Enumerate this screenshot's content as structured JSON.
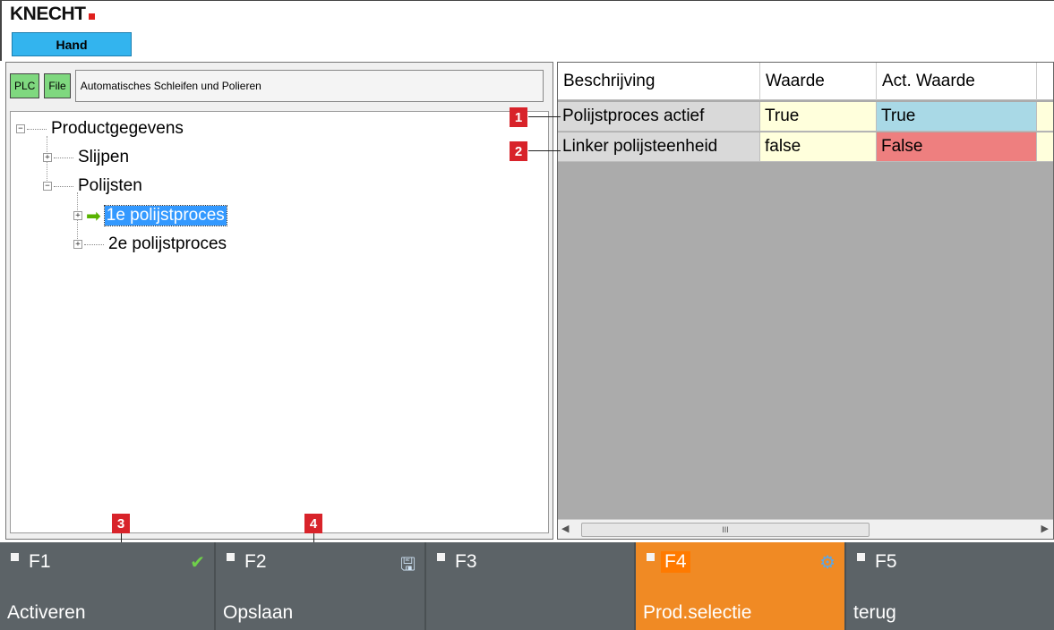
{
  "header": {
    "logo_text": "KNECHT",
    "mode": "Hand"
  },
  "left_panel": {
    "path_buttons": [
      "PLC",
      "File"
    ],
    "path_text": "Automatisches Schleifen und Polieren",
    "tree": [
      {
        "label": "Productgegevens",
        "toggle": "−",
        "level": 0
      },
      {
        "label": "Slijpen",
        "toggle": "+",
        "level": 1
      },
      {
        "label": "Polijsten",
        "toggle": "−",
        "level": 1
      },
      {
        "label": "1e polijstproces",
        "toggle": "+",
        "level": 2,
        "selected": true
      },
      {
        "label": "2e polijstproces",
        "toggle": "+",
        "level": 2
      }
    ]
  },
  "grid": {
    "columns": [
      "Beschrijving",
      "Waarde",
      "Act. Waarde"
    ],
    "rows": [
      {
        "description": "Polijstproces actief",
        "value": "True",
        "actual": "True",
        "actual_color": "#a9d9e6"
      },
      {
        "description": "Linker polijsteenheid",
        "value": "false",
        "actual": "False",
        "actual_color": "#ee7f7f"
      }
    ],
    "scroll_grip": "III"
  },
  "callouts": [
    "1",
    "2",
    "3",
    "4"
  ],
  "function_keys": [
    {
      "code": "F1",
      "label": "Activeren",
      "icon": "check-icon",
      "glyph": "✔",
      "icon_color": "#6fd04a",
      "active": false
    },
    {
      "code": "F2",
      "label": "Opslaan",
      "icon": "save-icon",
      "glyph": "🖫",
      "icon_color": "#cfe3f5",
      "active": false
    },
    {
      "code": "F3",
      "label": "",
      "active": false
    },
    {
      "code": "F4",
      "label": "Prod.selectie",
      "icon": "gear-icon",
      "glyph": "⚙",
      "icon_color": "#5aa7e8",
      "active": true
    },
    {
      "code": "F5",
      "label": "terug",
      "active": false
    }
  ],
  "colors": {
    "function_bar": "#5c6367",
    "active_key": "#f08a24",
    "mode_badge": "#33b4ee",
    "callout": "#d8232a"
  }
}
